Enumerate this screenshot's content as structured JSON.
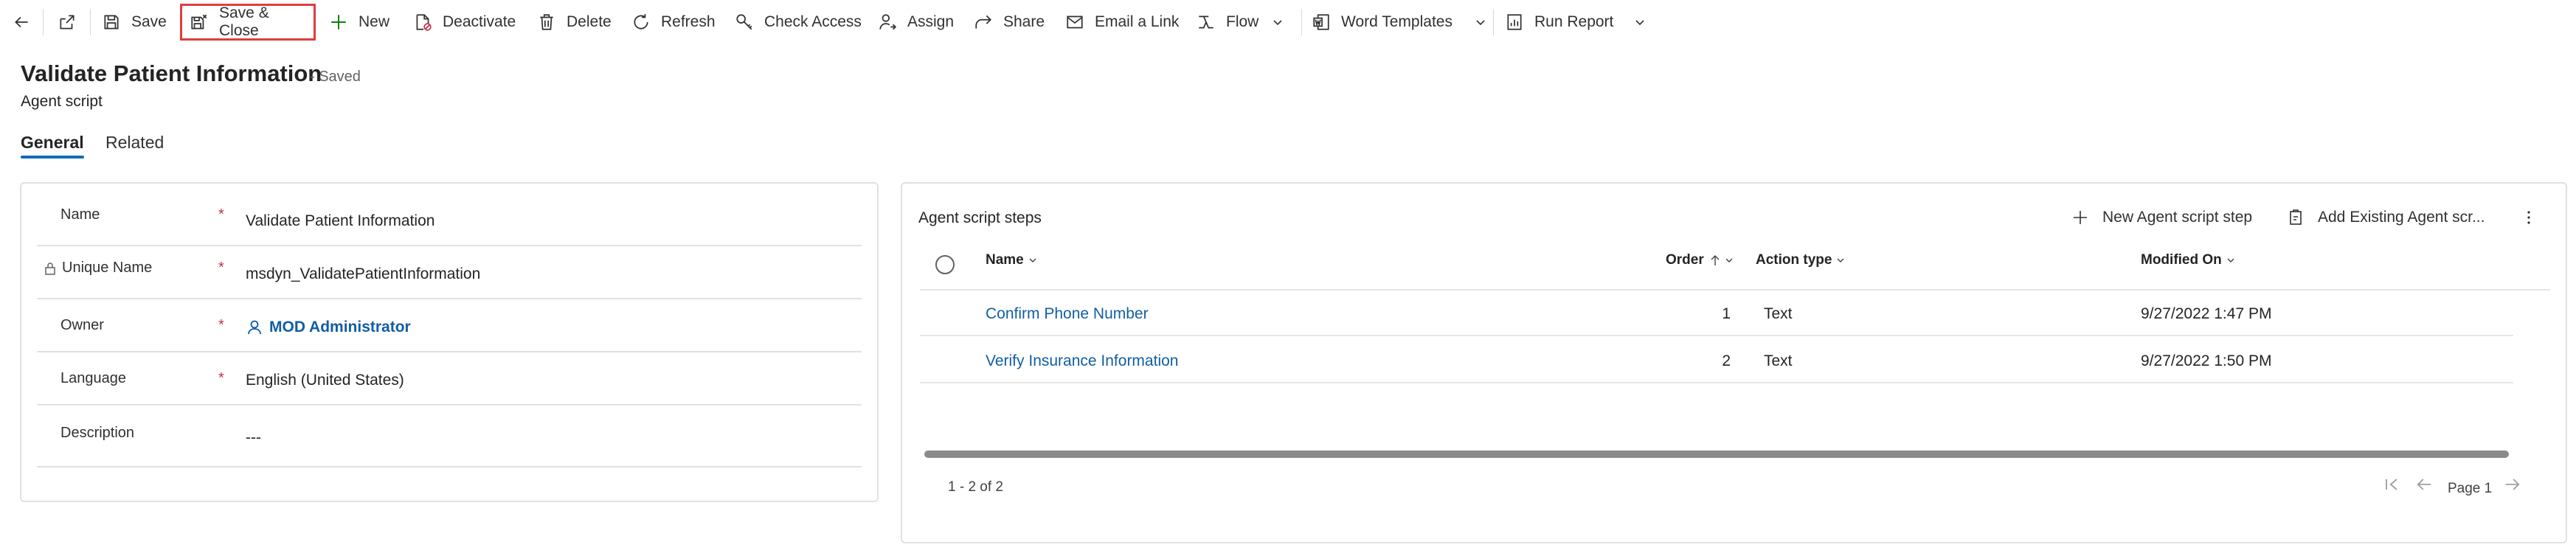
{
  "commandbar": {
    "back_icon": "back-arrow-icon",
    "popout_icon": "open-in-new-window-icon",
    "save": "Save",
    "save_close": "Save & Close",
    "new": "New",
    "deactivate": "Deactivate",
    "delete": "Delete",
    "refresh": "Refresh",
    "check_access": "Check Access",
    "assign": "Assign",
    "share": "Share",
    "email_link": "Email a Link",
    "flow": "Flow",
    "word_templates": "Word Templates",
    "run_report": "Run Report"
  },
  "header": {
    "title": "Validate Patient Information",
    "status": "- Saved",
    "entity": "Agent script"
  },
  "tabs": [
    {
      "label": "General",
      "active": true
    },
    {
      "label": "Related",
      "active": false
    }
  ],
  "form": {
    "fields": [
      {
        "label": "Name",
        "required": "*",
        "value": "Validate Patient Information"
      },
      {
        "label": "Unique Name",
        "required": "*",
        "value": "msdyn_ValidatePatientInformation",
        "locked": true
      },
      {
        "label": "Owner",
        "required": "*",
        "value": "MOD Administrator",
        "lookup": true
      },
      {
        "label": "Language",
        "required": "*",
        "value": "English (United States)"
      },
      {
        "label": "Description",
        "required": "",
        "value": "---"
      }
    ]
  },
  "subgrid": {
    "title": "Agent script steps",
    "new_button": "New Agent script step",
    "add_existing_button": "Add Existing Agent scr...",
    "columns": {
      "name": "Name",
      "order": "Order",
      "action_type": "Action type",
      "modified_on": "Modified On"
    },
    "rows": [
      {
        "name": "Confirm Phone Number",
        "order": "1",
        "action_type": "Text",
        "modified_on": "9/27/2022 1:47 PM"
      },
      {
        "name": "Verify Insurance Information",
        "order": "2",
        "action_type": "Text",
        "modified_on": "9/27/2022 1:50 PM"
      }
    ],
    "record_count": "1 - 2 of 2",
    "page_label": "Page 1"
  },
  "colors": {
    "accent": "#0f6cbd",
    "link": "#115ea3",
    "required": "#c4314b",
    "focus_outline": "#e23d3d"
  }
}
